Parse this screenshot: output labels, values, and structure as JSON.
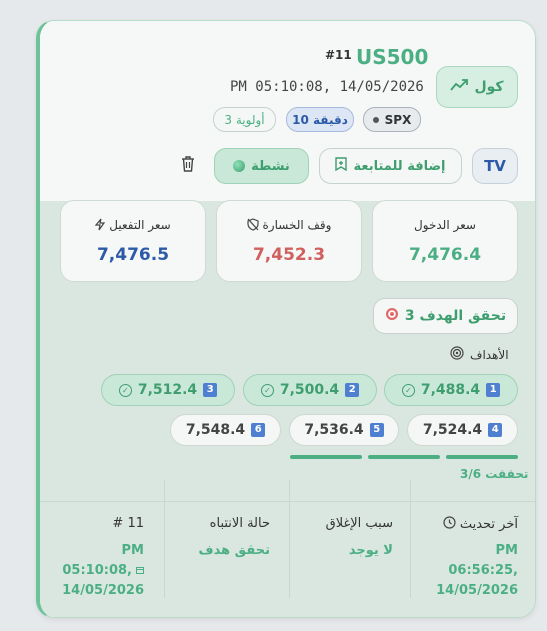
{
  "header": {
    "symbol": "US500",
    "signal_id": "#11",
    "datetime": "PM 05:10:08, 14/05/2026",
    "direction_label": "كول",
    "tags": {
      "index": "SPX",
      "timeframe": "10 دقيقة",
      "priority": "أولوية 3"
    }
  },
  "actions": {
    "tv_label": "TV",
    "watch_label": "إضافة للمتابعة",
    "status_label": "نشطة"
  },
  "prices": {
    "entry_label": "سعر الدخول",
    "entry_value": "7,476.4",
    "stop_label": "وقف الخسارة",
    "stop_value": "7,452.3",
    "trigger_label": "سعر التفعيل",
    "trigger_value": "7,476.5"
  },
  "target_hit": {
    "label": "تحقق الهدف 3"
  },
  "targets": {
    "title": "الأهداف",
    "items": [
      {
        "num": "1",
        "value": "7,488.4",
        "hit": true
      },
      {
        "num": "2",
        "value": "7,500.4",
        "hit": true
      },
      {
        "num": "3",
        "value": "7,512.4",
        "hit": true
      },
      {
        "num": "4",
        "value": "7,524.4",
        "hit": false
      },
      {
        "num": "5",
        "value": "7,536.4",
        "hit": false
      },
      {
        "num": "6",
        "value": "7,548.4",
        "hit": false
      }
    ],
    "progress_text": "3/6 تحققت",
    "progress_fraction": 0.5
  },
  "footer": {
    "last_update_label": "آخر تحديث",
    "last_update_time": "PM",
    "last_update_time2": "06:56:25,",
    "last_update_date": "14/05/2026",
    "close_reason_label": "سبب الإغلاق",
    "close_reason_value": "لا يوجد",
    "alert_state_label": "حالة الانتباه",
    "alert_state_value": "تحقق هدف",
    "id_label": "# 11",
    "id_time": "PM",
    "id_time2": "05:10:08,",
    "id_date": "14/05/2026"
  },
  "colors": {
    "accent_green": "#4caf84",
    "stop_red": "#d0605e",
    "trigger_blue": "#2c5aa8"
  }
}
